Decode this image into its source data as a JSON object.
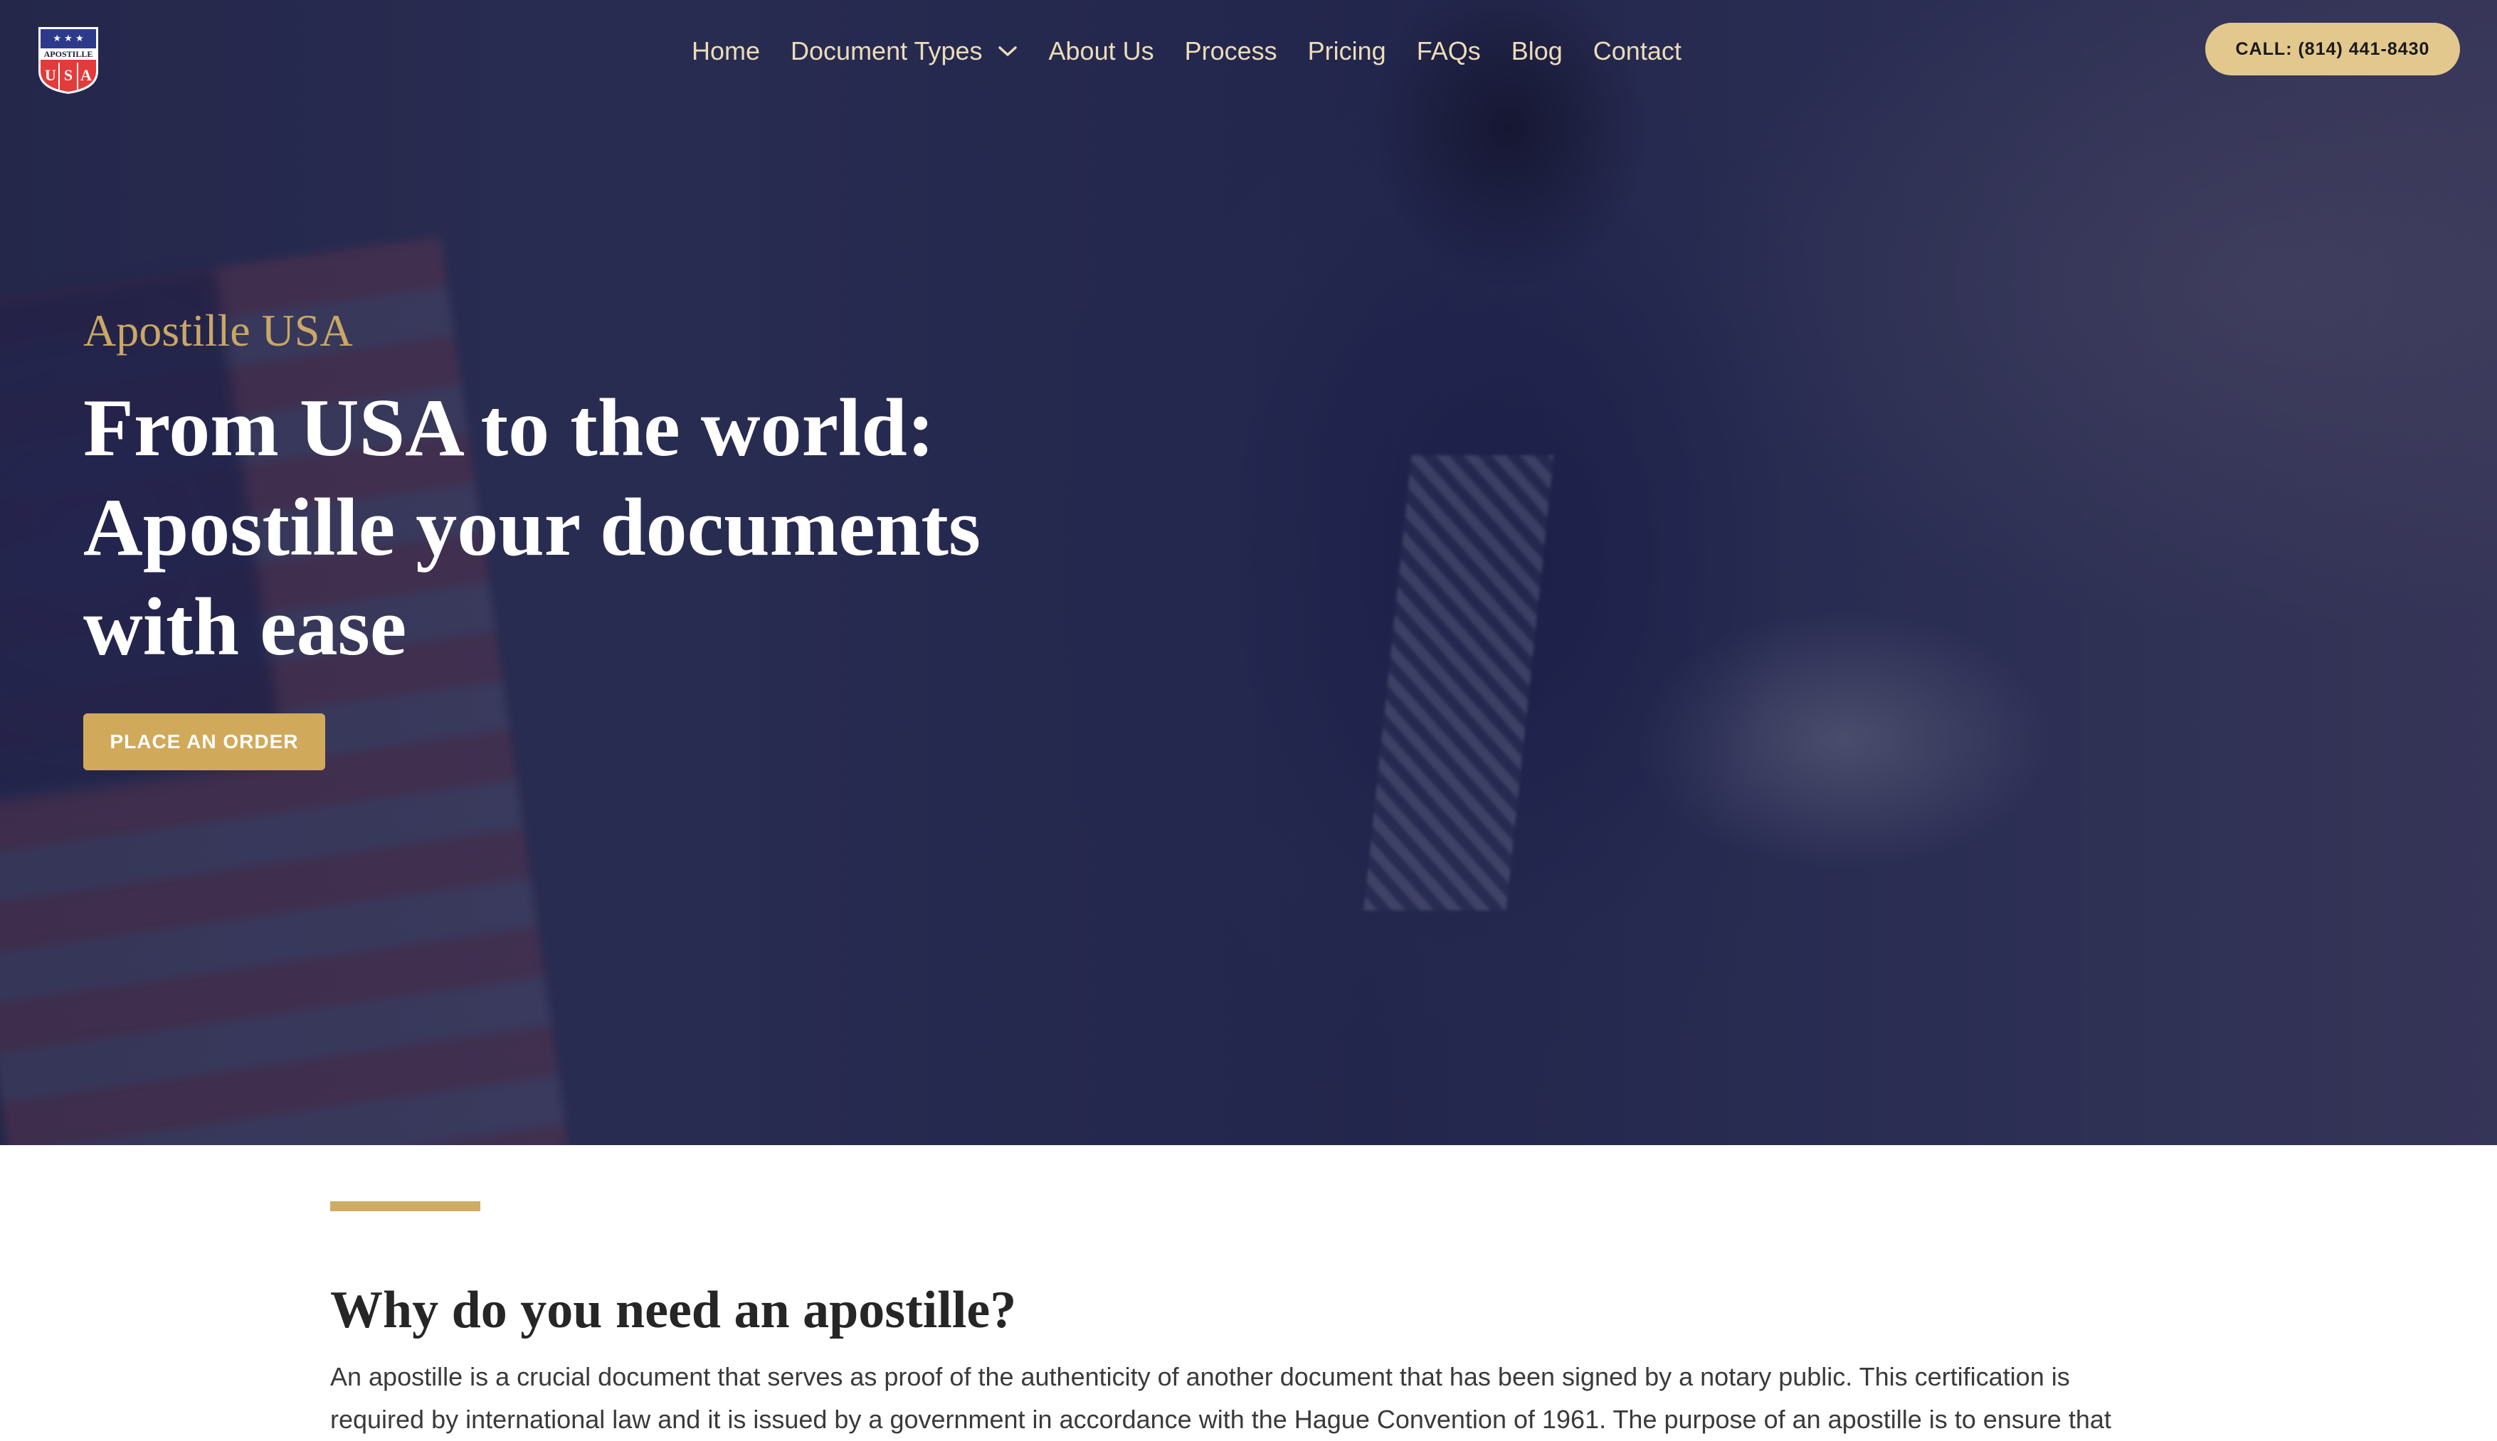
{
  "header": {
    "logo": {
      "stars": "★ ★ ★",
      "word": "APOSTILLE",
      "letters": [
        "U",
        "S",
        "A"
      ]
    },
    "nav": [
      {
        "label": "Home"
      },
      {
        "label": "Document Types",
        "has_dropdown": true
      },
      {
        "label": "About Us"
      },
      {
        "label": "Process"
      },
      {
        "label": "Pricing"
      },
      {
        "label": "FAQs"
      },
      {
        "label": "Blog"
      },
      {
        "label": "Contact"
      }
    ],
    "call_button": "CALL: (814) 441-8430"
  },
  "hero": {
    "eyebrow": "Apostille USA",
    "headline": "From USA to the world: Apostille your documents with ease",
    "cta_label": "PLACE AN ORDER"
  },
  "section": {
    "title": "Why do you need an apostille?",
    "body": "An apostille is a crucial document that serves as proof of the authenticity of another document that has been signed by a notary public. This certification is required by international law and it is issued by a government in accordance with the Hague Convention of 1961. The purpose of an apostille is to ensure that"
  },
  "colors": {
    "accent_gold": "#cfac63",
    "button_gold": "#d1a95a",
    "call_button_bg": "#e3c88e",
    "nav_text": "#ecdcb8",
    "hero_overlay": "#2a2d55"
  },
  "icons": {
    "dropdown": "chevron-down-icon",
    "logo": "apostille-usa-logo"
  }
}
